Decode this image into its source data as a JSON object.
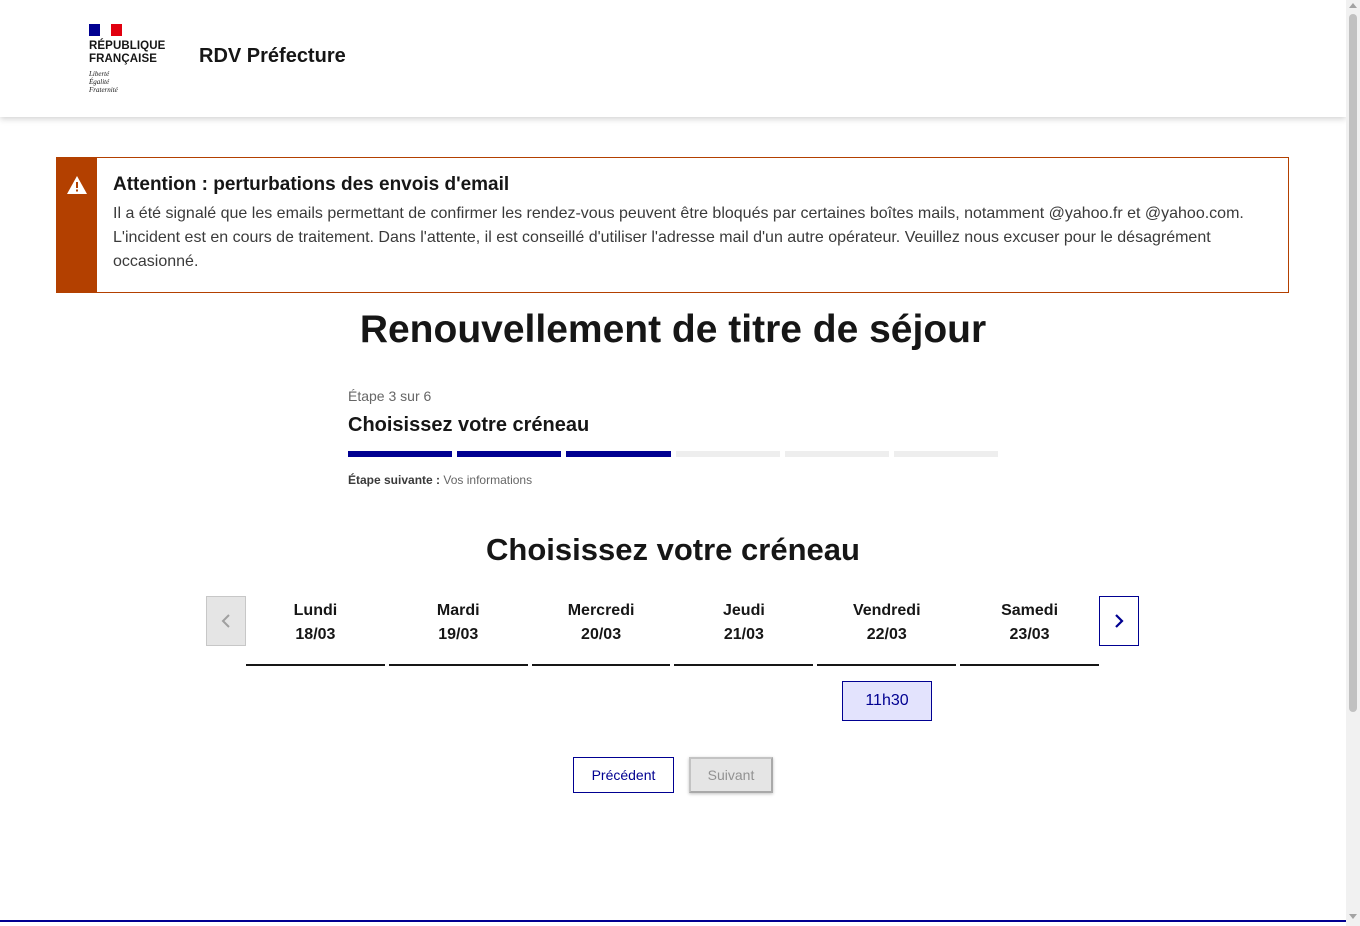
{
  "header": {
    "republic_line1": "RÉPUBLIQUE",
    "republic_line2": "FRANÇAISE",
    "motto_line1": "Liberté",
    "motto_line2": "Égalité",
    "motto_line3": "Fraternité",
    "site_title": "RDV Préfecture",
    "flag_colors": [
      "#000091",
      "#ffffff",
      "#e1000f"
    ]
  },
  "alert": {
    "icon": "warning-icon",
    "color": "#b34000",
    "title": "Attention : perturbations des envois d'email",
    "text": "Il a été signalé que les emails permettant de confirmer les rendez-vous peuvent être bloqués par certaines boîtes mails, notamment @yahoo.fr et @yahoo.com. L'incident est en cours de traitement. Dans l'attente, il est conseillé d'utiliser l'adresse mail d'un autre opérateur. Veuillez nous excuser pour le désagrément occasionné."
  },
  "page_title": "Renouvellement de titre de séjour",
  "stepper": {
    "state": "Étape 3 sur 6",
    "title": "Choisissez votre créneau",
    "total_steps": 6,
    "current_step": 3,
    "next_label": "Étape suivante :",
    "next_value": "Vos informations",
    "active_color": "#000091",
    "inactive_color": "#eeeeee"
  },
  "section_title": "Choisissez votre créneau",
  "calendar": {
    "prev_icon": "chevron-left-icon",
    "next_icon": "chevron-right-icon",
    "days": [
      {
        "name": "Lundi",
        "date": "18/03"
      },
      {
        "name": "Mardi",
        "date": "19/03"
      },
      {
        "name": "Mercredi",
        "date": "20/03"
      },
      {
        "name": "Jeudi",
        "date": "21/03"
      },
      {
        "name": "Vendredi",
        "date": "22/03"
      },
      {
        "name": "Samedi",
        "date": "23/03"
      }
    ],
    "slots": [
      {
        "day": "Vendredi",
        "time": "11h30"
      }
    ]
  },
  "buttons": {
    "previous": "Précédent",
    "next": "Suivant"
  },
  "accent_color": "#000091"
}
